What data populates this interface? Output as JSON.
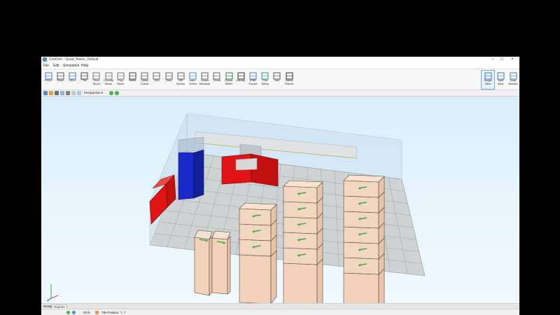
{
  "window": {
    "title": "CoolSim - Quad_Aisles_Default"
  },
  "menu": [
    "File",
    "Edit",
    "Simulation",
    "Help"
  ],
  "toolbar": [
    {
      "label": "CRAC",
      "icon": "crac-icon"
    },
    {
      "label": "Rack",
      "icon": "rack-icon"
    },
    {
      "label": "HDU",
      "icon": "hdu-icon"
    },
    {
      "label": "Tile",
      "icon": "tile-icon"
    },
    {
      "label": "Rect\nBlock",
      "icon": "rect-block-icon"
    },
    {
      "label": "Circular\nBlock",
      "icon": "circular-block-icon"
    },
    {
      "label": "Poly\nBlock",
      "icon": "poly-block-icon"
    },
    {
      "label": "Baffle",
      "icon": "baffle-icon"
    },
    {
      "label": "Cable\nCutout",
      "icon": "cable-cutout-icon"
    },
    {
      "label": "Grill",
      "icon": "grill-icon"
    },
    {
      "label": "Duct",
      "icon": "duct-icon"
    },
    {
      "label": "HB\nSensor",
      "icon": "sensor-icon"
    },
    {
      "label": "Inlet /\nOutlet",
      "icon": "inlet-outlet-icon"
    },
    {
      "label": "Smart\nMeasure",
      "icon": "measure-icon"
    },
    {
      "label": "Clone",
      "icon": "clone-icon"
    },
    {
      "label": "Power\nMeter",
      "icon": "power-meter-icon"
    },
    {
      "label": "Library",
      "icon": "library-icon"
    },
    {
      "label": "IPBE\nReport",
      "icon": "report-icon"
    },
    {
      "label": "Plot\nSetup",
      "icon": "plot-setup-icon"
    },
    {
      "label": "Axe",
      "icon": "axe-icon"
    },
    {
      "label": "Status\nReport",
      "icon": "status-report-icon"
    }
  ],
  "view_buttons": [
    {
      "label": "Single\nView",
      "icon": "single-view-icon"
    },
    {
      "label": "Split\nView",
      "icon": "split-view-icon"
    },
    {
      "label": "Dual\nMonitor",
      "icon": "dual-monitor-icon"
    }
  ],
  "quick_toolbar": {
    "projection": "Perspective"
  },
  "bottom_tabs": [
    "Design",
    "Reports"
  ],
  "status": {
    "mode": "IDLE",
    "tile_position": "Tile Position: ?, ?"
  },
  "colors": {
    "crac": "#e01414",
    "hdu": "#1a27c9",
    "rack": "#f2d2bb",
    "floor": "#cfd3d3",
    "arrow": "#3fae3f",
    "grid": "#9aa4a4"
  }
}
